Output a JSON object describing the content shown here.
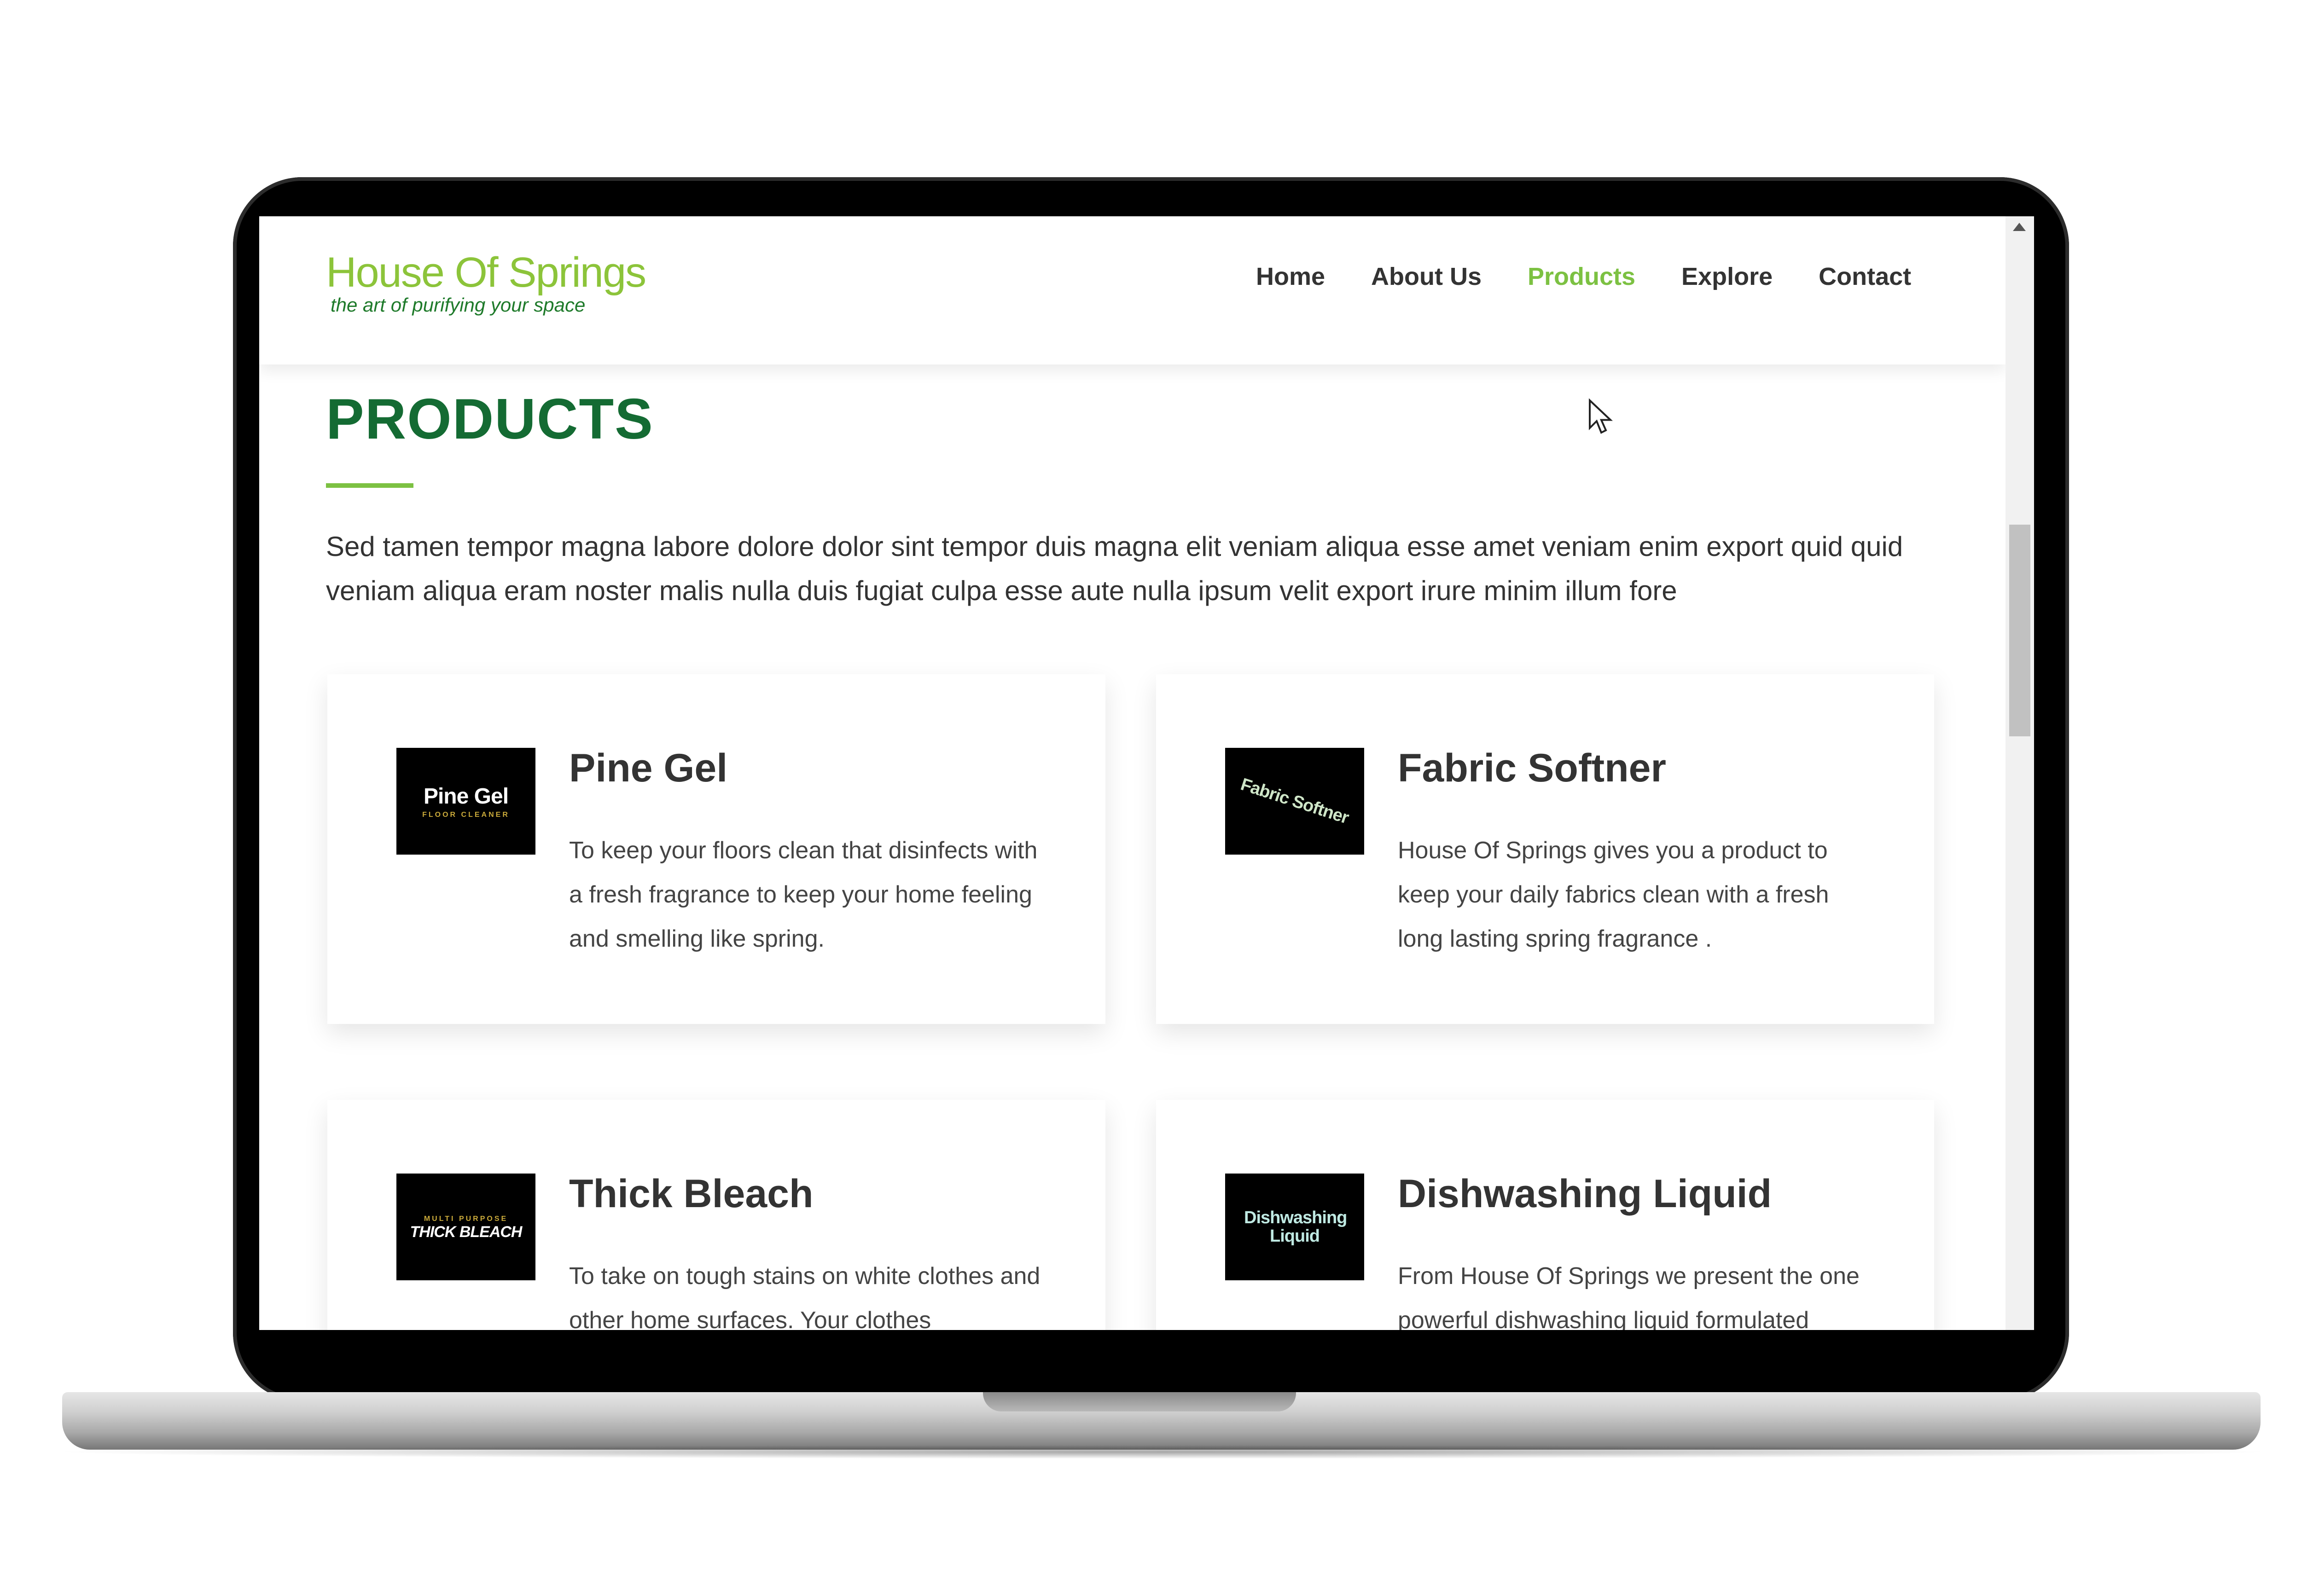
{
  "site": {
    "logo": {
      "name": "House Of Springs",
      "tagline": "the art of purifying your space"
    },
    "nav": [
      {
        "label": "Home",
        "active": false
      },
      {
        "label": "About Us",
        "active": false
      },
      {
        "label": "Products",
        "active": true
      },
      {
        "label": "Explore",
        "active": false
      },
      {
        "label": "Contact",
        "active": false
      }
    ]
  },
  "page": {
    "title": "PRODUCTS",
    "intro": "Sed tamen tempor magna labore dolore dolor sint tempor duis magna elit veniam aliqua esse amet veniam enim export quid quid veniam aliqua eram noster malis nulla duis fugiat culpa esse aute nulla ipsum velit export irure minim illum fore"
  },
  "products": [
    {
      "name": "Pine Gel",
      "thumb_text": "Pine Gel",
      "thumb_sub": "FLOOR CLEANER",
      "description": "To keep your floors clean that disinfects with a fresh fragrance to keep your home feeling and smelling like spring."
    },
    {
      "name": "Fabric Softner",
      "thumb_text": "Fabric Softner",
      "thumb_sub": "",
      "description": "House Of Springs gives you a product to keep your daily fabrics clean with a fresh long lasting spring fragrance ."
    },
    {
      "name": "Thick Bleach",
      "thumb_text": "THICK BLEACH",
      "thumb_sub": "MULTI PURPOSE",
      "description": "To take on tough stains on white clothes and other home surfaces. Your clothes"
    },
    {
      "name": "Dishwashing Liquid",
      "thumb_text": "Dishwashing Liquid",
      "thumb_sub": "",
      "description": "From House Of Springs we present the one powerful dishwashing liquid formulated"
    }
  ],
  "colors": {
    "accent": "#7cc142",
    "title": "#146b33",
    "text": "#333333"
  }
}
